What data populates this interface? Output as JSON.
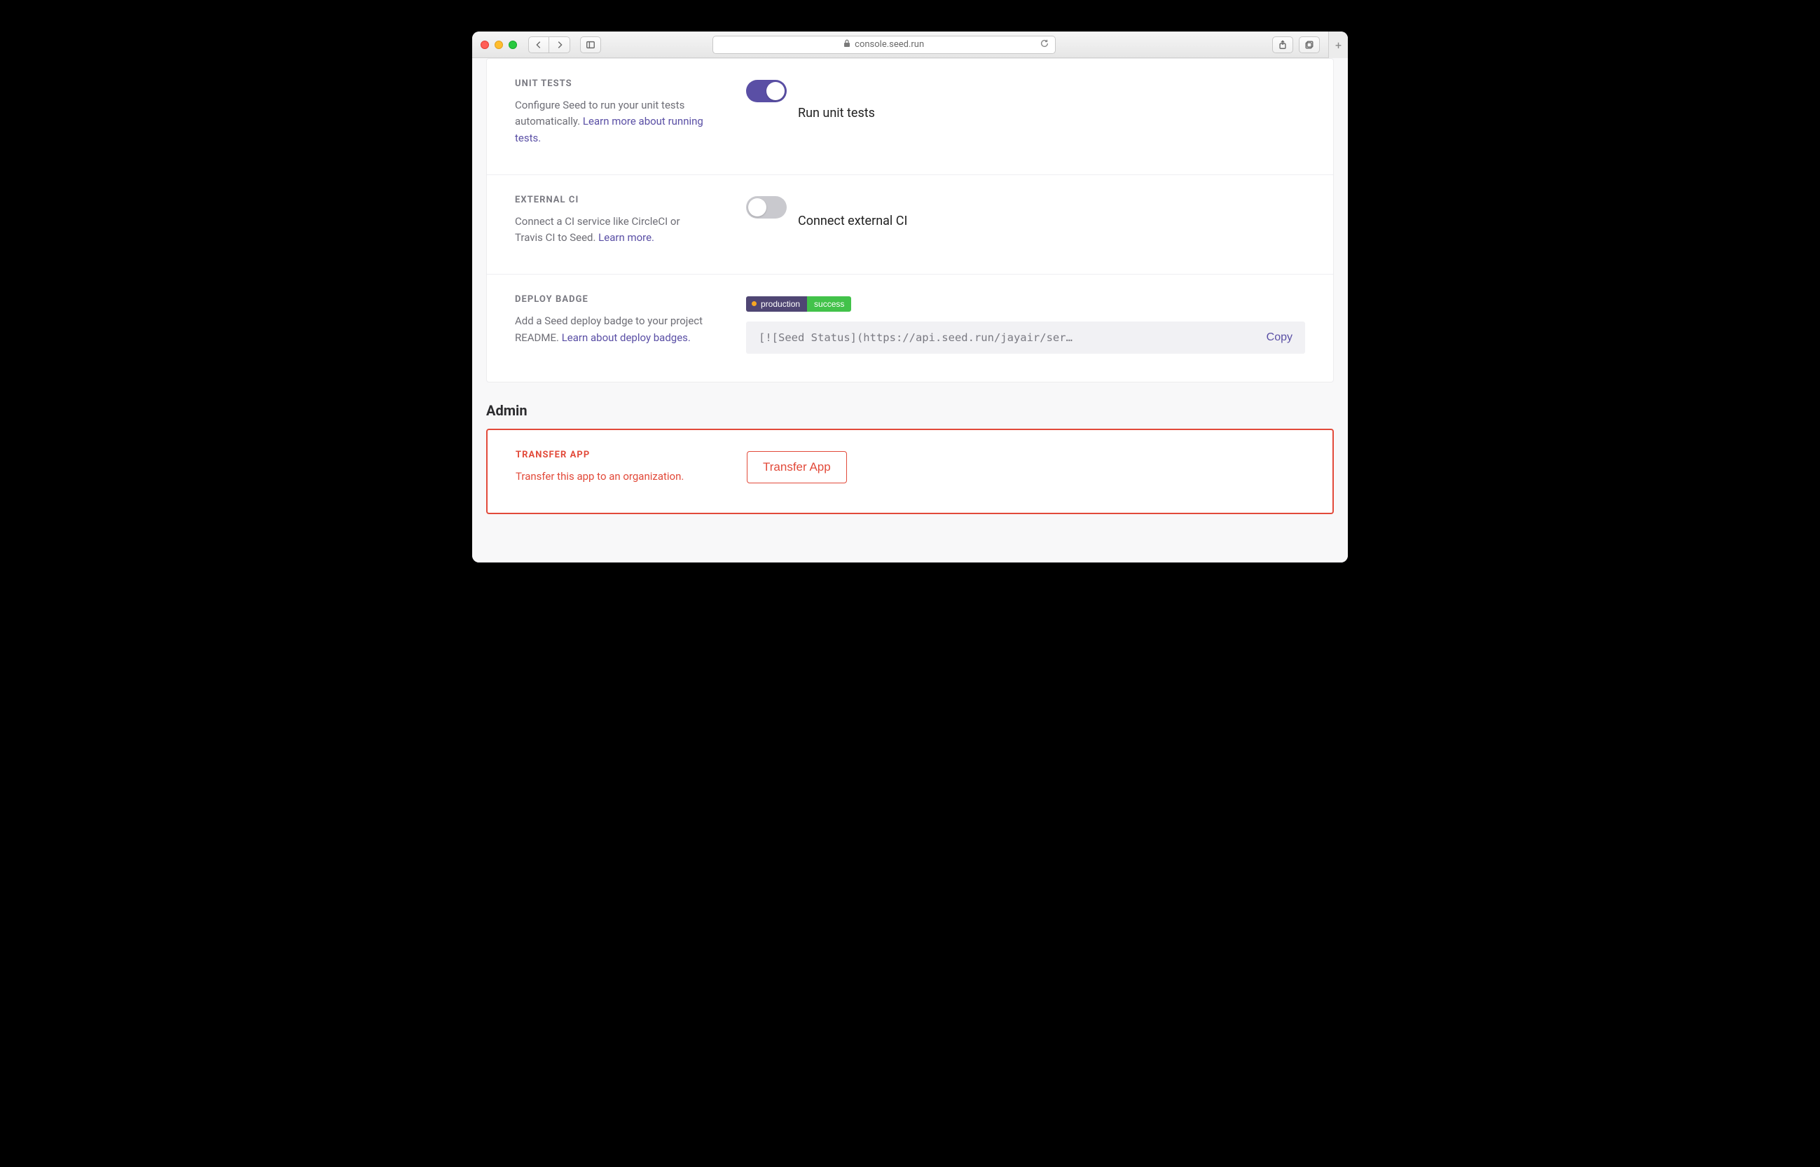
{
  "browser": {
    "url_label": "console.seed.run"
  },
  "sections": {
    "unit_tests": {
      "title": "UNIT TESTS",
      "desc_a": "Configure Seed to run your unit tests automatically. ",
      "link": "Learn more about running tests.",
      "toggle_label": "Run unit tests",
      "enabled": true
    },
    "external_ci": {
      "title": "EXTERNAL CI",
      "desc_a": "Connect a CI service like CircleCI or Travis CI to Seed. ",
      "link": "Learn more.",
      "toggle_label": "Connect external CI",
      "enabled": false
    },
    "deploy_badge": {
      "title": "DEPLOY BADGE",
      "desc_a": "Add a Seed deploy badge to your project README. ",
      "link": "Learn about deploy badges.",
      "badge_left": "production",
      "badge_right": "success",
      "code": "[![Seed Status](https://api.seed.run/jayair/ser…",
      "copy": "Copy"
    }
  },
  "admin": {
    "heading": "Admin",
    "transfer": {
      "title": "TRANSFER APP",
      "desc": "Transfer this app to an organization.",
      "button": "Transfer App"
    }
  }
}
